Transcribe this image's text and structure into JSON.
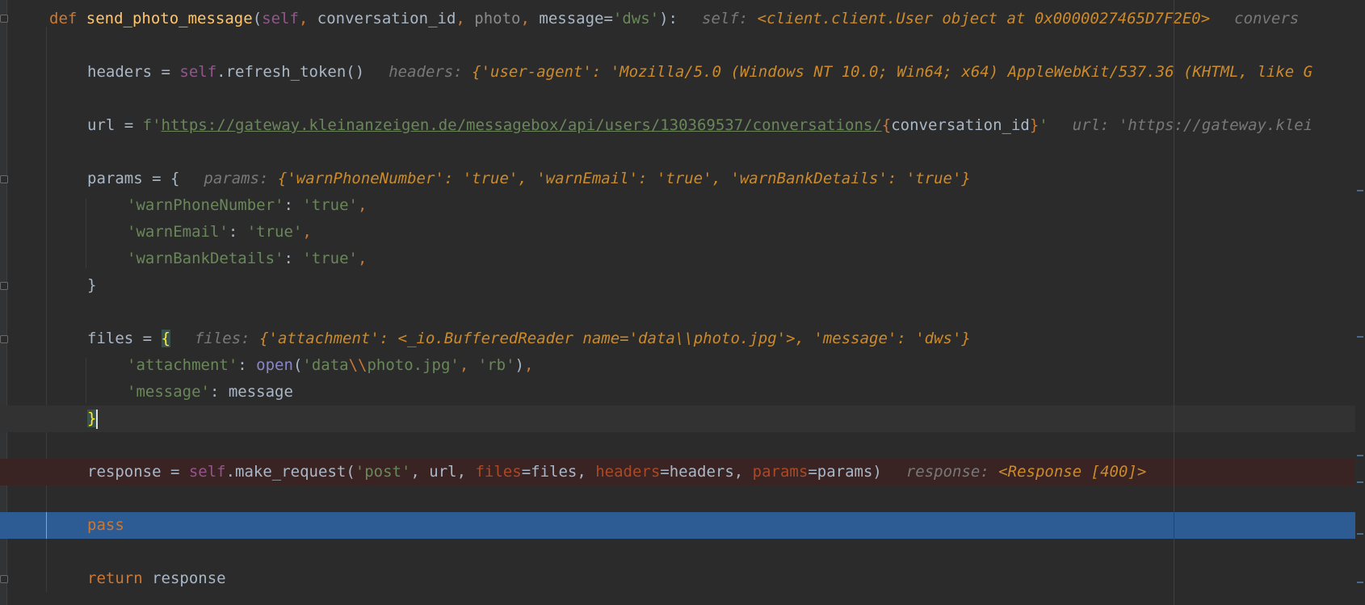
{
  "editor": {
    "line1": {
      "kw_def": "def",
      "fn_name": "send_photo_message",
      "open": "(",
      "p_self": "self",
      "comma1": ", ",
      "p_conv": "conversation_id",
      "comma2": ", ",
      "p_photo": "photo",
      "comma3": ", ",
      "p_message": "message",
      "eq": "=",
      "default": "'dws'",
      "close": "):",
      "hint_name": "self:",
      "hint_val": "<client.client.User object at 0x0000027465D7F2E0>",
      "hint2_name": "convers"
    },
    "line2": {
      "lhs": "headers = ",
      "self": "self",
      "rhs": ".refresh_token()",
      "hint_name": "headers:",
      "hint_val": "{'user-agent': 'Mozilla/5.0 (Windows NT 10.0; Win64; x64) AppleWebKit/537.36 (KHTML, like G"
    },
    "line3": {
      "lhs": "url = ",
      "fprefix": "f'",
      "link": "https://gateway.kleinanzeigen.de/messagebox/api/users/130369537/conversations/",
      "lbrace": "{",
      "var": "conversation_id",
      "rbrace": "}",
      "quote": "'",
      "hint_name": "url:",
      "hint_val": "'https://gateway.klei"
    },
    "line4": {
      "lhs": "params = {",
      "hint_name": "params:",
      "hint_val": "{'warnPhoneNumber': 'true', 'warnEmail': 'true', 'warnBankDetails': 'true'}"
    },
    "line5": {
      "key": "'warnPhoneNumber'",
      "colon": ": ",
      "val": "'true'",
      "comma": ","
    },
    "line6": {
      "key": "'warnEmail'",
      "colon": ": ",
      "val": "'true'",
      "comma": ","
    },
    "line7": {
      "key": "'warnBankDetails'",
      "colon": ": ",
      "val": "'true'",
      "comma": ","
    },
    "line8": {
      "text": "}"
    },
    "line9": {
      "lhs": "files = ",
      "brace": "{",
      "hint_name": "files:",
      "hint_val": "{'attachment': <_io.BufferedReader name='data\\\\photo.jpg'>, 'message': 'dws'}"
    },
    "line10": {
      "key": "'attachment'",
      "colon": ": ",
      "fn": "open",
      "open": "(",
      "s1a": "'data",
      "esc": "\\\\",
      "s1b": "photo.jpg'",
      "comma": ", ",
      "s2": "'rb'",
      "close": ")",
      "comma2": ","
    },
    "line11": {
      "key": "'message'",
      "colon": ": ",
      "val": "message"
    },
    "line12": {
      "brace": "}"
    },
    "line13": {
      "lhs": "response = ",
      "self": "self",
      "call": ".make_request(",
      "s_post": "'post'",
      "c1": ", url, ",
      "k_files": "files",
      "v_files": "=files, ",
      "k_headers": "headers",
      "v_headers": "=headers, ",
      "k_params": "params",
      "v_params": "=params)",
      "hint_name": "response:",
      "hint_val": "<Response [400]>"
    },
    "line14": {
      "kw": "pass"
    },
    "line15": {
      "kw": "return",
      "rest": " response"
    }
  }
}
